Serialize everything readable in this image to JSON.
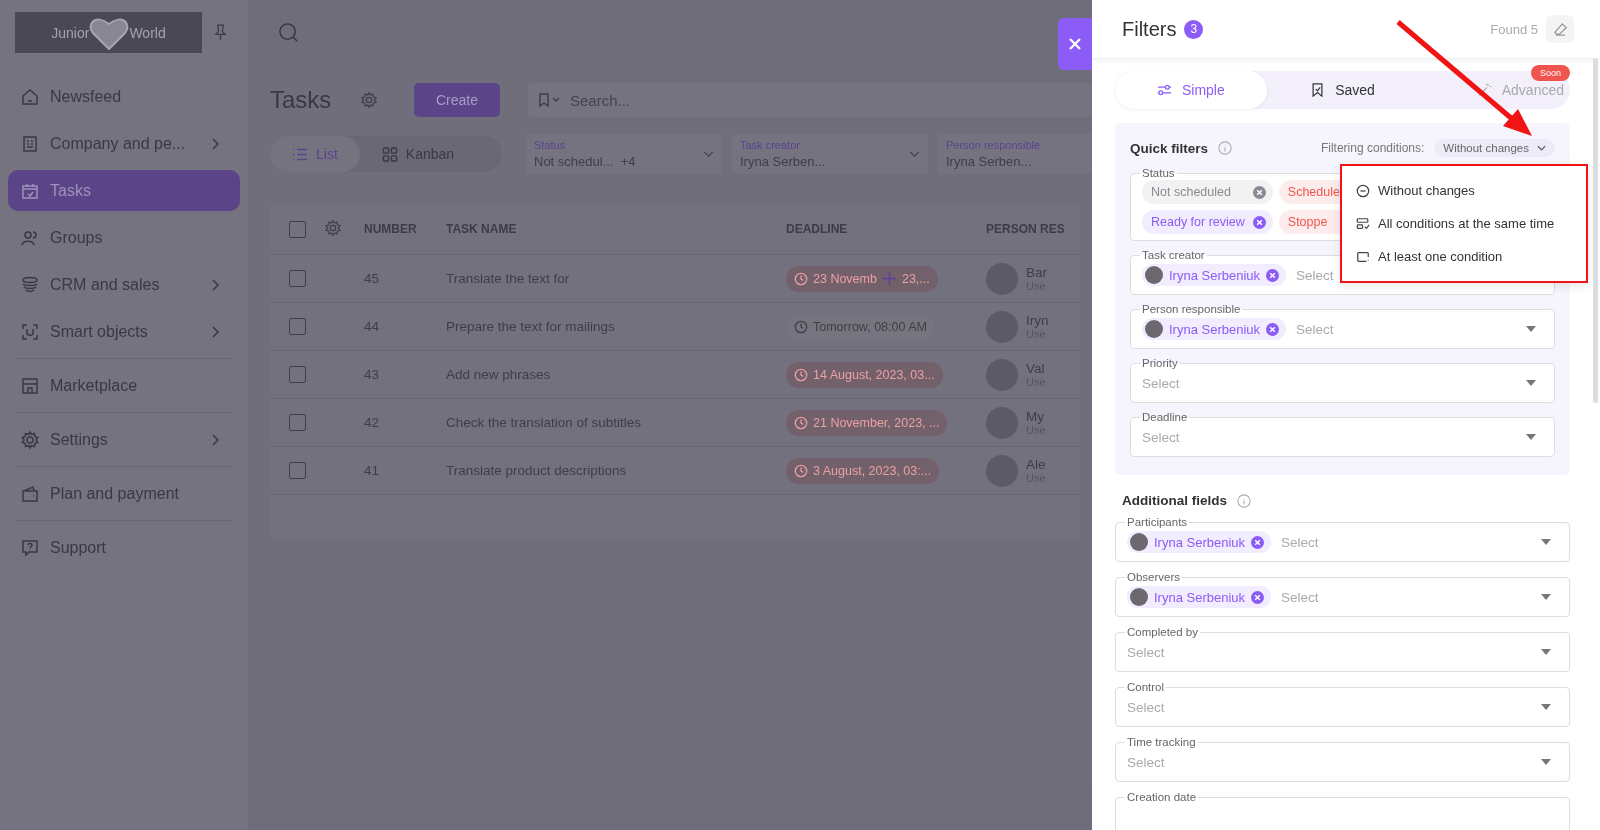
{
  "sidebar": {
    "logo": {
      "left": "Junior",
      "right": "World"
    },
    "sections": [
      {
        "items": [
          {
            "label": "Newsfeed",
            "kind": "home",
            "submenu": false,
            "selected": false
          },
          {
            "label": "Company and pe...",
            "kind": "building",
            "submenu": true,
            "selected": false
          },
          {
            "label": "Tasks",
            "kind": "calendar",
            "submenu": false,
            "selected": true
          },
          {
            "label": "Groups",
            "kind": "people",
            "submenu": false,
            "selected": false
          },
          {
            "label": "CRM and sales",
            "kind": "coins",
            "submenu": true,
            "selected": false
          },
          {
            "label": "Smart objects",
            "kind": "scan",
            "submenu": true,
            "selected": false
          }
        ]
      },
      {
        "items": [
          {
            "label": "Marketplace",
            "kind": "store",
            "submenu": false,
            "selected": false
          }
        ]
      },
      {
        "items": [
          {
            "label": "Settings",
            "kind": "gear",
            "submenu": true,
            "selected": false
          }
        ]
      },
      {
        "items": [
          {
            "label": "Plan and payment",
            "kind": "wallet",
            "submenu": false,
            "selected": false
          }
        ]
      },
      {
        "items": [
          {
            "label": "Support",
            "kind": "help",
            "submenu": false,
            "selected": false
          }
        ]
      }
    ]
  },
  "tasks": {
    "title": "Tasks",
    "create": "Create",
    "search_placeholder": "Search...",
    "views": [
      {
        "label": "List",
        "kind": "list",
        "selected": true
      },
      {
        "label": "Kanban",
        "kind": "grid",
        "selected": false
      }
    ],
    "quick_filters": [
      {
        "label": "Status",
        "value": "Not schedul...",
        "extra": "+4"
      },
      {
        "label": "Task creator",
        "value": "Iryna Serben..."
      },
      {
        "label": "Person responsible",
        "value": "Iryna Serben..."
      }
    ],
    "table": {
      "all_checked": false,
      "columns": [
        "NUMBER",
        "TASK NAME",
        "DEADLINE",
        "PERSON RES"
      ],
      "rows": [
        {
          "checked": false,
          "number": "45",
          "name": "Translate the text for",
          "deadline": "23 Novemb",
          "deadline_rest": "23,...",
          "overdue": true,
          "person": "Bar",
          "role": "Use"
        },
        {
          "checked": false,
          "number": "44",
          "name": "Prepare the text for mailings",
          "deadline": "Tomorrow, 08:00 AM",
          "overdue": false,
          "person": "Iryn",
          "role": "Use"
        },
        {
          "checked": false,
          "number": "43",
          "name": "Add new phrases",
          "deadline": "14 August, 2023, 03...",
          "overdue": true,
          "person": "Val",
          "role": "Use"
        },
        {
          "checked": false,
          "number": "42",
          "name": "Check the translation of subtitles",
          "deadline": "21 November, 2023, ...",
          "overdue": true,
          "person": "My",
          "role": "Use"
        },
        {
          "checked": false,
          "number": "41",
          "name": "Translate product descriptions",
          "deadline": "3 August, 2023, 03:...",
          "overdue": true,
          "person": "Ale",
          "role": "Use"
        }
      ]
    }
  },
  "filters": {
    "title": "Filters",
    "count": "3",
    "found": "Found 5",
    "tabs": [
      {
        "label": "Simple",
        "kind": "sliders",
        "selected": true,
        "disabled": false
      },
      {
        "label": "Saved",
        "kind": "bookmark",
        "selected": false,
        "disabled": false
      },
      {
        "label": "Advanced",
        "kind": "wand",
        "selected": false,
        "disabled": true,
        "badge": "Soon"
      }
    ],
    "quick": {
      "title": "Quick filters",
      "conditions_label": "Filtering conditions:",
      "conditions_value": "Without changes",
      "fields": [
        {
          "label": "Status",
          "chips": [
            {
              "label": "Not scheduled",
              "color": "#8a8a94"
            },
            {
              "label": "Schedule",
              "color": "#f0544f"
            },
            {
              "label": "Ready for review",
              "color": "#8b5cf6"
            },
            {
              "label": "Stoppe",
              "color": "#f0544f"
            }
          ]
        },
        {
          "label": "Task creator",
          "people": [
            "Iryna Serbeniuk"
          ],
          "placeholder": "Select"
        },
        {
          "label": "Person responsible",
          "people": [
            "Iryna Serbeniuk"
          ],
          "placeholder": "Select"
        },
        {
          "label": "Priority",
          "placeholder": "Select"
        },
        {
          "label": "Deadline",
          "placeholder": "Select"
        }
      ]
    },
    "additional": {
      "title": "Additional fields",
      "fields": [
        {
          "label": "Participants",
          "people": [
            "Iryna Serbeniuk"
          ],
          "placeholder": "Select"
        },
        {
          "label": "Observers",
          "people": [
            "Iryna Serbeniuk"
          ],
          "placeholder": "Select"
        },
        {
          "label": "Completed by",
          "placeholder": "Select"
        },
        {
          "label": "Control",
          "placeholder": "Select"
        },
        {
          "label": "Time tracking",
          "placeholder": "Select"
        },
        {
          "label": "Creation date"
        }
      ]
    },
    "menu": [
      {
        "label": "Without changes",
        "kind": "minus"
      },
      {
        "label": "All conditions at the same time",
        "kind": "all"
      },
      {
        "label": "At least one condition",
        "kind": "one"
      }
    ]
  }
}
